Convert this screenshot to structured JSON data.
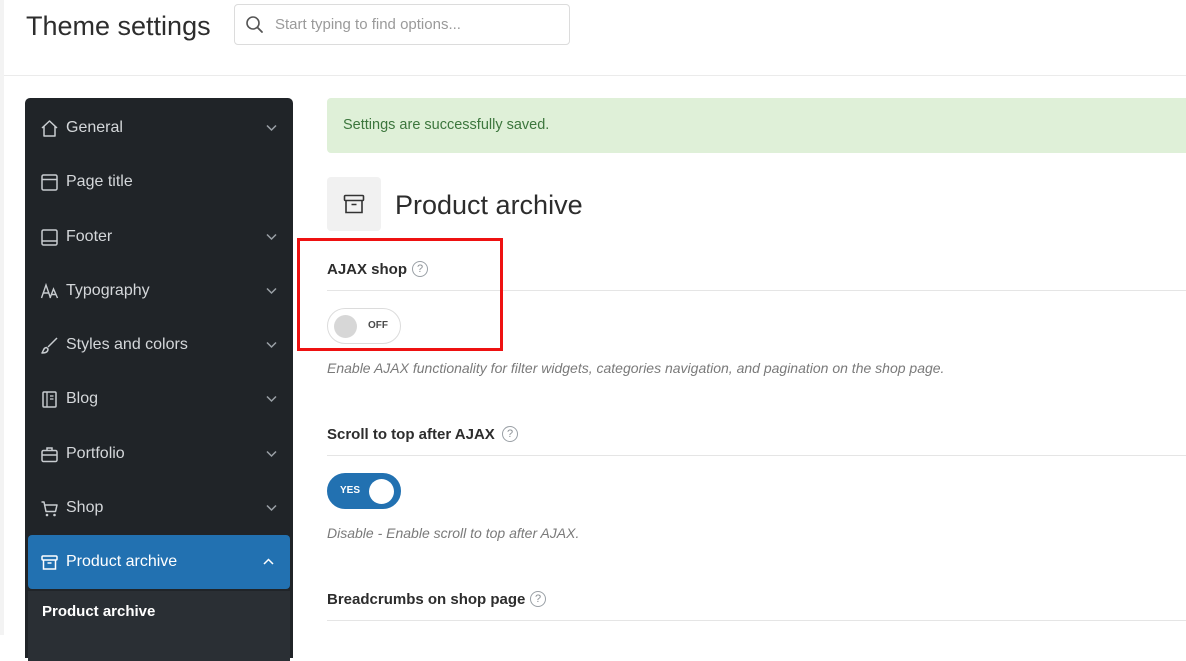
{
  "header": {
    "title": "Theme settings",
    "search_placeholder": "Start typing to find options..."
  },
  "sidebar": {
    "items": [
      {
        "label": "General",
        "icon": "home-icon",
        "has_chevron": true
      },
      {
        "label": "Page title",
        "icon": "page-title-icon",
        "has_chevron": false
      },
      {
        "label": "Footer",
        "icon": "footer-icon",
        "has_chevron": true
      },
      {
        "label": "Typography",
        "icon": "typography-icon",
        "has_chevron": true
      },
      {
        "label": "Styles and colors",
        "icon": "brush-icon",
        "has_chevron": true
      },
      {
        "label": "Blog",
        "icon": "blog-icon",
        "has_chevron": true
      },
      {
        "label": "Portfolio",
        "icon": "briefcase-icon",
        "has_chevron": true
      },
      {
        "label": "Shop",
        "icon": "cart-icon",
        "has_chevron": true
      },
      {
        "label": "Product archive",
        "icon": "archive-icon",
        "has_chevron": true,
        "active": true
      }
    ],
    "subitems": [
      {
        "label": "Product archive",
        "active": true
      }
    ]
  },
  "notice": {
    "text": "Settings are successfully saved."
  },
  "section": {
    "title": "Product archive",
    "icon": "archive-icon"
  },
  "options": [
    {
      "title": "AJAX shop",
      "toggle_state": "OFF",
      "description": "Enable AJAX functionality for filter widgets, categories navigation, and pagination on the shop page."
    },
    {
      "title": "Scroll to top after AJAX",
      "toggle_state": "YES",
      "description": "Disable - Enable scroll to top after AJAX."
    },
    {
      "title": "Breadcrumbs on shop page"
    }
  ],
  "colors": {
    "sidebar_bg": "#202428",
    "accent": "#2271b1",
    "notice_bg": "#dff0d8",
    "notice_text": "#3c763d",
    "highlight": "#ee1111"
  }
}
